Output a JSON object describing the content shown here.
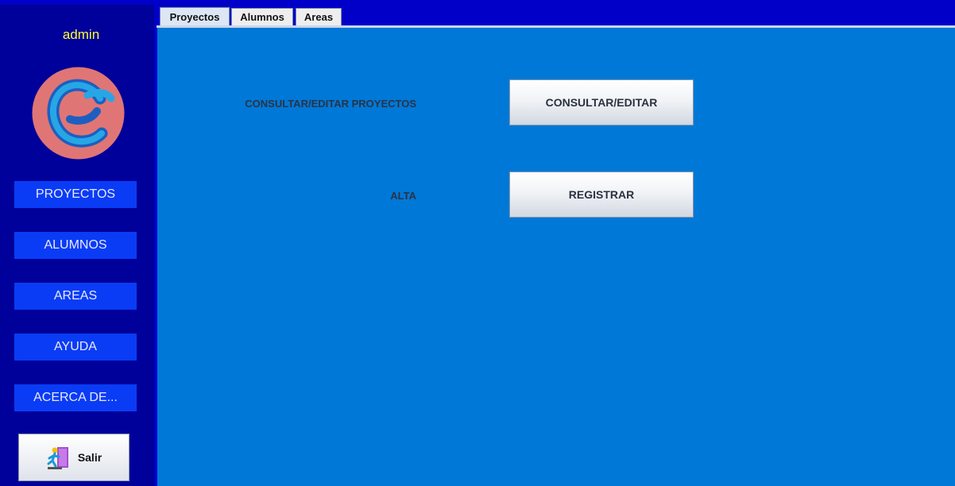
{
  "sidebar": {
    "username": "admin",
    "items": [
      {
        "label": "PROYECTOS"
      },
      {
        "label": "ALUMNOS"
      },
      {
        "label": "AREAS"
      },
      {
        "label": "AYUDA"
      },
      {
        "label": "ACERCA DE..."
      }
    ],
    "exit_label": "Salir"
  },
  "tabs": [
    {
      "label": "Proyectos",
      "active": true
    },
    {
      "label": "Alumnos",
      "active": false
    },
    {
      "label": "Areas",
      "active": false
    }
  ],
  "main": {
    "rows": [
      {
        "label": "CONSULTAR/EDITAR PROYECTOS",
        "button": "CONSULTAR/EDITAR"
      },
      {
        "label": "ALTA",
        "button": "REGISTRAR"
      }
    ]
  },
  "colors": {
    "sidebar_bg": "#00009a",
    "content_bg": "#0078d7",
    "sidebar_button": "#0a3cf5",
    "username": "#ffff33"
  }
}
